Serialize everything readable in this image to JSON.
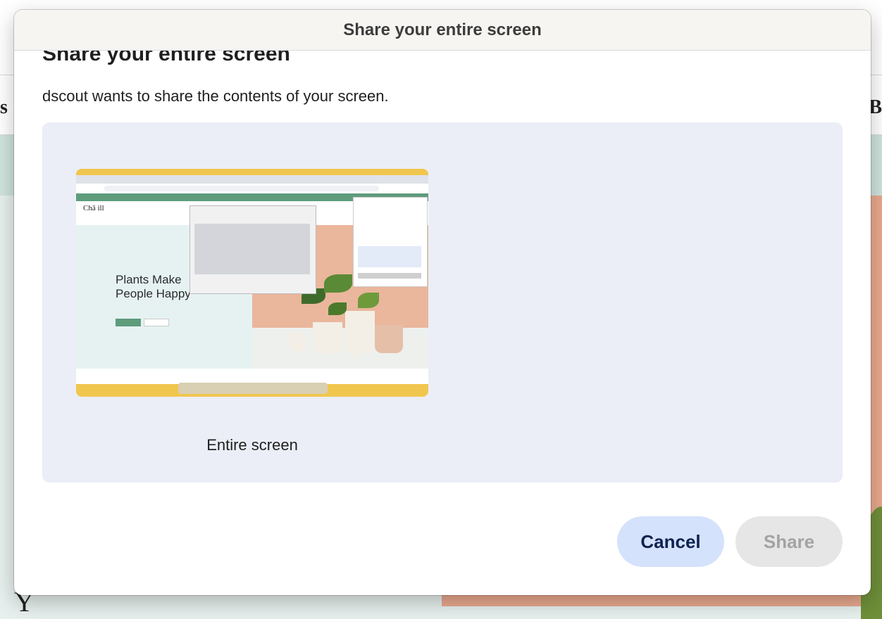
{
  "background": {
    "nav_left_letter": "s",
    "nav_right_letter": "B",
    "bottom_letter": "Y"
  },
  "dialog": {
    "window_title": "Share your entire screen",
    "heading": "Share your entire screen",
    "description": "dscout wants to share the contents of your screen.",
    "sources": [
      {
        "label": "Entire screen",
        "preview": {
          "logo": "Châ    ill",
          "hero_title_line1": "Plants Make",
          "hero_title_line2": "People Happy"
        }
      }
    ],
    "buttons": {
      "cancel": "Cancel",
      "share": "Share"
    }
  },
  "colors": {
    "panel_bg": "#ebeef6",
    "cancel_bg": "#d5e2fb",
    "cancel_text": "#0f2350",
    "share_disabled_bg": "#e6e6e6",
    "share_disabled_text": "#a3a3a3",
    "preview_brand_green": "#5e9c7c",
    "preview_menubar_yellow": "#f0c64e"
  }
}
